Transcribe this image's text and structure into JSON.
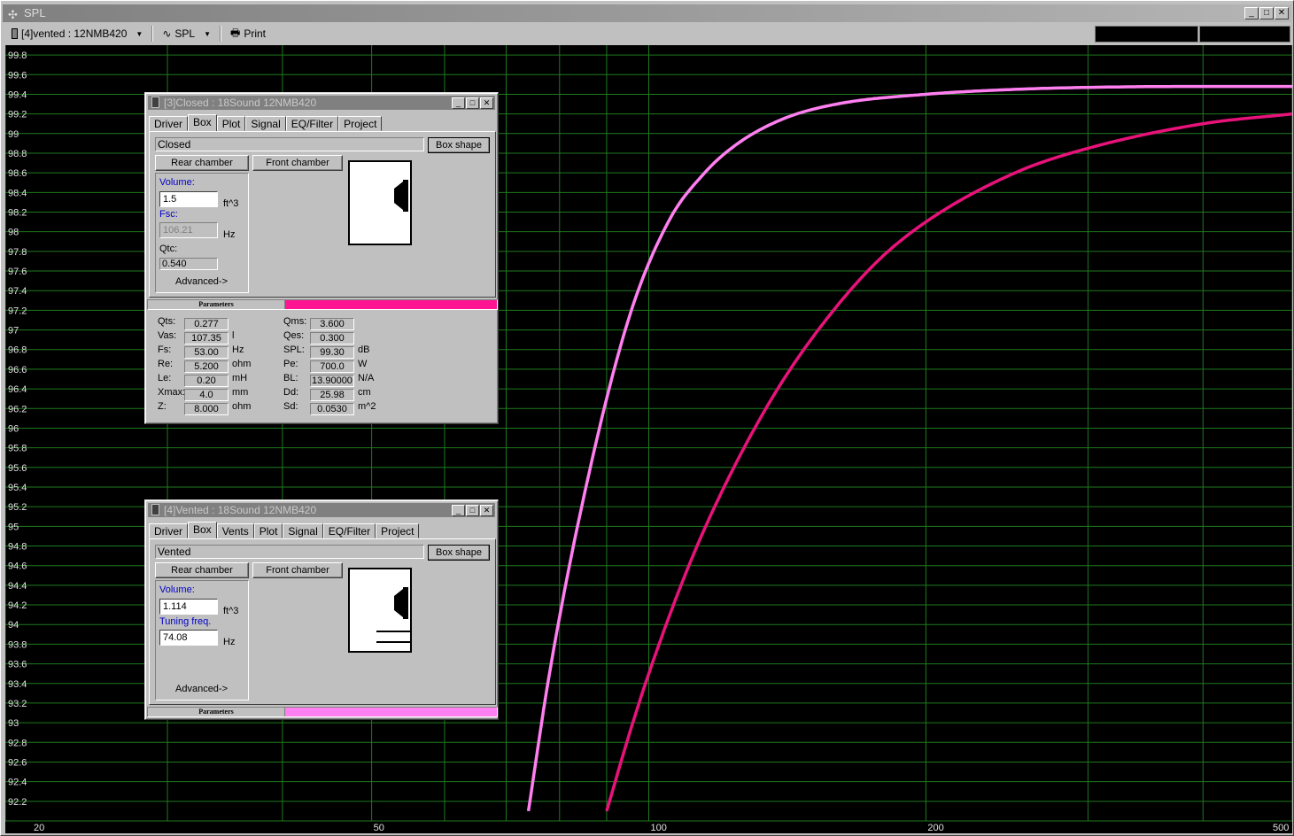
{
  "window": {
    "title": "SPL"
  },
  "toolbar": {
    "project_label": "[4]vented : 12NMB420",
    "graph_label": "SPL",
    "print_label": "Print"
  },
  "chart_data": {
    "type": "line",
    "xscale": "log",
    "xlim": [
      20,
      500
    ],
    "ylim": [
      92.0,
      99.9
    ],
    "x_ticks": [
      20,
      50,
      100,
      200,
      500
    ],
    "y_ticks": [
      "99.8",
      "99.6",
      "99.4",
      "99.2",
      "99",
      "98.8",
      "98.6",
      "98.4",
      "98.2",
      "98",
      "97.8",
      "97.6",
      "97.4",
      "97.2",
      "97",
      "96.8",
      "96.6",
      "96.4",
      "96.2",
      "96",
      "95.8",
      "95.6",
      "95.4",
      "95.2",
      "95",
      "94.8",
      "94.6",
      "94.4",
      "94.2",
      "94",
      "93.8",
      "93.6",
      "93.4",
      "93.2",
      "93",
      "92.8",
      "92.6",
      "92.4",
      "92.2"
    ],
    "grid": true,
    "background": "#000000",
    "grid_color": "#1e7a1e",
    "series": [
      {
        "color": "#ff7ff0",
        "x": [
          74,
          78,
          85,
          95,
          105,
          115,
          125,
          140,
          160,
          200,
          250,
          300,
          400,
          500
        ],
        "y": [
          92.1,
          93.5,
          95.3,
          97.1,
          98.1,
          98.6,
          98.9,
          99.15,
          99.3,
          99.4,
          99.45,
          99.47,
          99.48,
          99.48
        ]
      },
      {
        "color": "#e8127a",
        "x": [
          90,
          95,
          100,
          110,
          120,
          135,
          150,
          175,
          200,
          250,
          300,
          400,
          500
        ],
        "y": [
          92.1,
          92.85,
          93.5,
          94.55,
          95.35,
          96.25,
          96.9,
          97.65,
          98.1,
          98.6,
          98.85,
          99.1,
          99.2
        ]
      }
    ]
  },
  "closed_window": {
    "title": "[3]Closed : 18Sound 12NMB420",
    "tabs": [
      "Driver",
      "Box",
      "Plot",
      "Signal",
      "EQ/Filter",
      "Project"
    ],
    "active_tab": "Box",
    "box_type": "Closed",
    "box_shape_label": "Box shape",
    "rear_chamber_label": "Rear chamber",
    "front_chamber_label": "Front chamber",
    "volume_label": "Volume:",
    "volume_value": "1.5",
    "volume_unit": "ft^3",
    "fsc_label": "Fsc:",
    "fsc_value": "106.21",
    "fsc_unit": "Hz",
    "qtc_label": "Qtc:",
    "qtc_value": "0.540",
    "advanced_label": "Advanced->",
    "parameters_label": "Parameters",
    "color": "#ff1493",
    "params_left": [
      {
        "label": "Qts:",
        "value": "0.277",
        "unit": ""
      },
      {
        "label": "Vas:",
        "value": "107.35",
        "unit": "l"
      },
      {
        "label": "Fs:",
        "value": "53.00",
        "unit": "Hz"
      },
      {
        "label": "Re:",
        "value": "5.200",
        "unit": "ohm"
      },
      {
        "label": "Le:",
        "value": "0.20",
        "unit": "mH"
      },
      {
        "label": "Xmax:",
        "value": "4.0",
        "unit": "mm"
      },
      {
        "label": "Z:",
        "value": "8.000",
        "unit": "ohm"
      }
    ],
    "params_right": [
      {
        "label": "Qms:",
        "value": "3.600",
        "unit": ""
      },
      {
        "label": "Qes:",
        "value": "0.300",
        "unit": ""
      },
      {
        "label": "SPL:",
        "value": "99.30",
        "unit": "dB"
      },
      {
        "label": "Pe:",
        "value": "700.0",
        "unit": "W"
      },
      {
        "label": "BL:",
        "value": "13.90000",
        "unit": "N/A"
      },
      {
        "label": "Dd:",
        "value": "25.98",
        "unit": "cm"
      },
      {
        "label": "Sd:",
        "value": "0.0530",
        "unit": "m^2"
      }
    ]
  },
  "vented_window": {
    "title": "[4]Vented : 18Sound 12NMB420",
    "tabs": [
      "Driver",
      "Box",
      "Vents",
      "Plot",
      "Signal",
      "EQ/Filter",
      "Project"
    ],
    "active_tab": "Box",
    "box_type": "Vented",
    "box_shape_label": "Box shape",
    "rear_chamber_label": "Rear chamber",
    "front_chamber_label": "Front chamber",
    "volume_label": "Volume:",
    "volume_value": "1.114",
    "volume_unit": "ft^3",
    "tuning_label": "Tuning freq.",
    "tuning_value": "74.08",
    "tuning_unit": "Hz",
    "advanced_label": "Advanced->",
    "parameters_label": "Parameters",
    "color": "#ff80f0"
  }
}
